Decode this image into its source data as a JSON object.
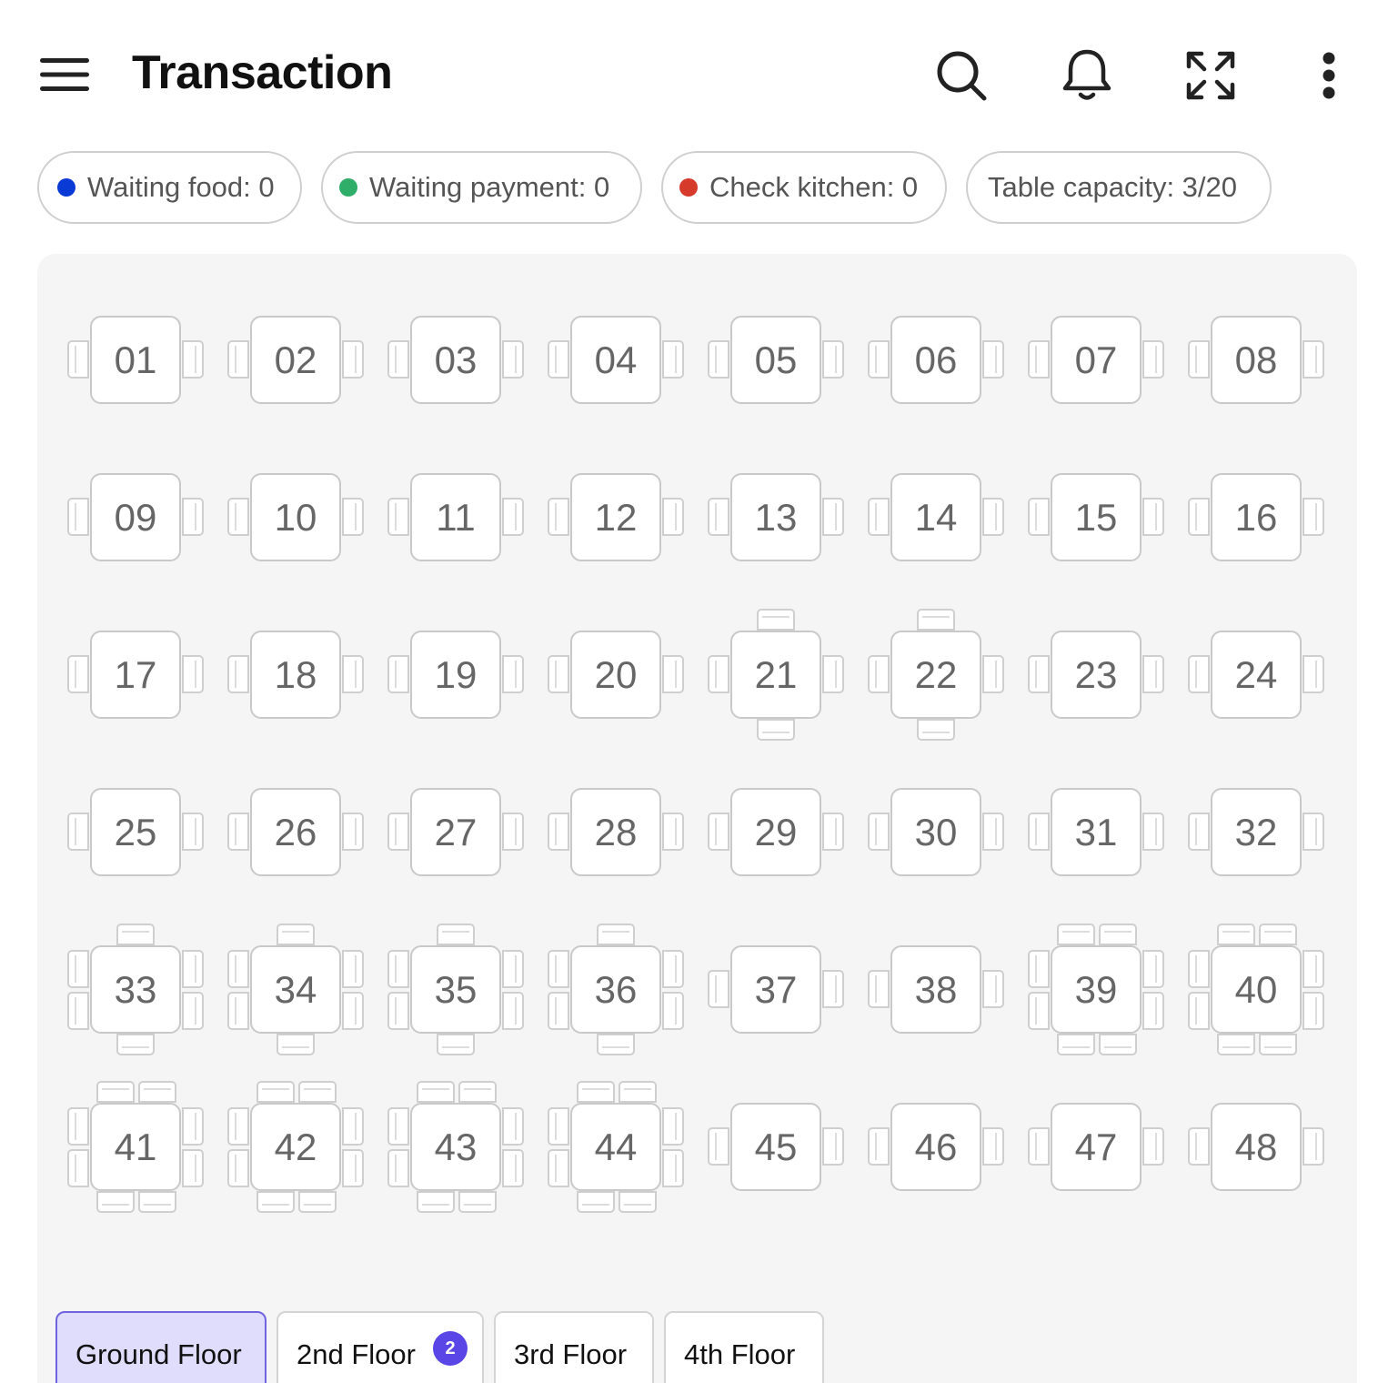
{
  "header": {
    "title": "Transaction",
    "icons": [
      "menu-icon",
      "search-icon",
      "bell-icon",
      "expand-icon",
      "more-vertical-icon"
    ]
  },
  "status_chips": [
    {
      "label": "Waiting food: 0",
      "dot_color": "#0a3ad6"
    },
    {
      "label": "Waiting payment: 0",
      "dot_color": "#2fae6a"
    },
    {
      "label": "Check kitchen: 0",
      "dot_color": "#d63a2b"
    },
    {
      "label": "Table capacity: 3/20"
    }
  ],
  "tables": [
    {
      "number": "01",
      "seats": 2
    },
    {
      "number": "02",
      "seats": 2
    },
    {
      "number": "03",
      "seats": 2
    },
    {
      "number": "04",
      "seats": 2
    },
    {
      "number": "05",
      "seats": 2
    },
    {
      "number": "06",
      "seats": 2
    },
    {
      "number": "07",
      "seats": 2
    },
    {
      "number": "08",
      "seats": 2
    },
    {
      "number": "09",
      "seats": 2
    },
    {
      "number": "10",
      "seats": 2
    },
    {
      "number": "11",
      "seats": 2
    },
    {
      "number": "12",
      "seats": 2
    },
    {
      "number": "13",
      "seats": 2
    },
    {
      "number": "14",
      "seats": 2
    },
    {
      "number": "15",
      "seats": 2
    },
    {
      "number": "16",
      "seats": 2
    },
    {
      "number": "17",
      "seats": 2
    },
    {
      "number": "18",
      "seats": 2
    },
    {
      "number": "19",
      "seats": 2
    },
    {
      "number": "20",
      "seats": 2
    },
    {
      "number": "21",
      "seats": 4
    },
    {
      "number": "22",
      "seats": 4
    },
    {
      "number": "23",
      "seats": 2
    },
    {
      "number": "24",
      "seats": 2
    },
    {
      "number": "25",
      "seats": 2
    },
    {
      "number": "26",
      "seats": 2
    },
    {
      "number": "27",
      "seats": 2
    },
    {
      "number": "28",
      "seats": 2
    },
    {
      "number": "29",
      "seats": 2
    },
    {
      "number": "30",
      "seats": 2
    },
    {
      "number": "31",
      "seats": 2
    },
    {
      "number": "32",
      "seats": 2
    },
    {
      "number": "33",
      "seats": 6
    },
    {
      "number": "34",
      "seats": 6
    },
    {
      "number": "35",
      "seats": 6
    },
    {
      "number": "36",
      "seats": 6
    },
    {
      "number": "37",
      "seats": 2
    },
    {
      "number": "38",
      "seats": 2
    },
    {
      "number": "39",
      "seats": 8
    },
    {
      "number": "40",
      "seats": 8
    },
    {
      "number": "41",
      "seats": 8
    },
    {
      "number": "42",
      "seats": 8
    },
    {
      "number": "43",
      "seats": 8
    },
    {
      "number": "44",
      "seats": 8
    },
    {
      "number": "45",
      "seats": 2
    },
    {
      "number": "46",
      "seats": 2
    },
    {
      "number": "47",
      "seats": 2
    },
    {
      "number": "48",
      "seats": 2
    }
  ],
  "floor_tabs": [
    {
      "label": "Ground Floor",
      "active": true
    },
    {
      "label": "2nd Floor",
      "badge": "2"
    },
    {
      "label": "3rd Floor"
    },
    {
      "label": "4th Floor"
    }
  ],
  "colors": {
    "accent": "#5a45e6",
    "active_tab_bg": "#e0dcfb",
    "floor_bg": "#f5f5f5"
  }
}
